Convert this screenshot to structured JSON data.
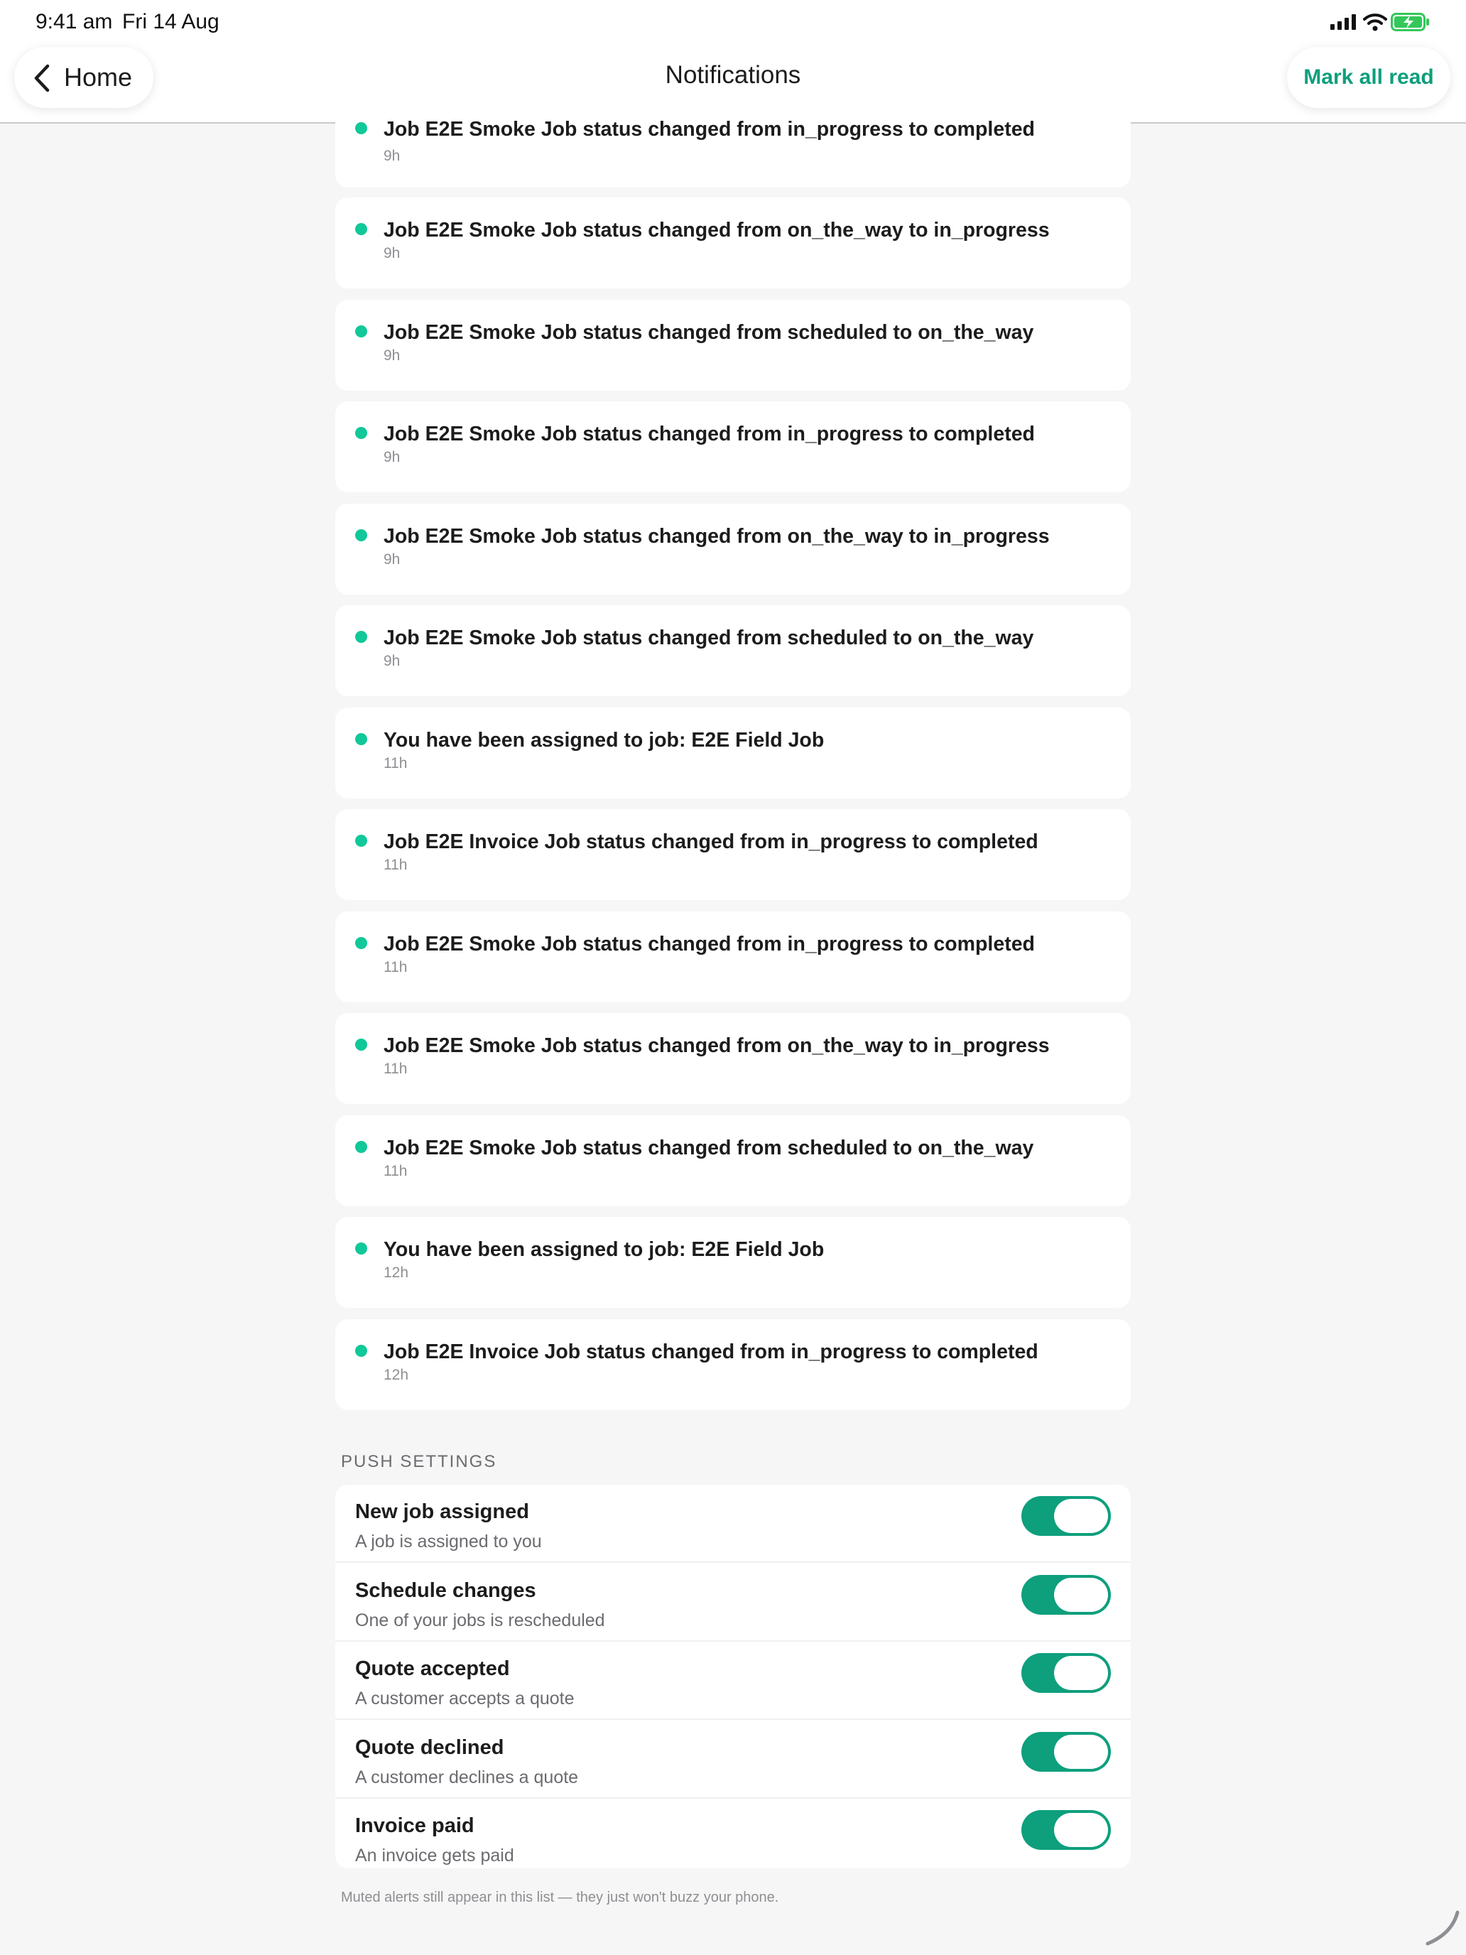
{
  "status_bar": {
    "time": "9:41 am",
    "date": "Fri 14 Aug",
    "icons": [
      "cellular-signal-icon",
      "wifi-icon",
      "battery-charging-icon"
    ],
    "battery_color": "#34c759"
  },
  "nav": {
    "back_label": "Home",
    "title": "Notifications",
    "action_label": "Mark all read"
  },
  "colors": {
    "accent": "#0e9f7c",
    "unread_dot": "#10c898"
  },
  "notifications": [
    {
      "text": "Job E2E Smoke Job status changed from in_progress to completed",
      "time": "9h",
      "unread": true
    },
    {
      "text": "Job E2E Smoke Job status changed from on_the_way to in_progress",
      "time": "9h",
      "unread": true
    },
    {
      "text": "Job E2E Smoke Job status changed from scheduled to on_the_way",
      "time": "9h",
      "unread": true
    },
    {
      "text": "Job E2E Smoke Job status changed from in_progress to completed",
      "time": "9h",
      "unread": true
    },
    {
      "text": "Job E2E Smoke Job status changed from on_the_way to in_progress",
      "time": "9h",
      "unread": true
    },
    {
      "text": "Job E2E Smoke Job status changed from scheduled to on_the_way",
      "time": "9h",
      "unread": true
    },
    {
      "text": "You have been assigned to job: E2E Field Job",
      "time": "11h",
      "unread": true
    },
    {
      "text": "Job E2E Invoice Job status changed from in_progress to completed",
      "time": "11h",
      "unread": true
    },
    {
      "text": "Job E2E Smoke Job status changed from in_progress to completed",
      "time": "11h",
      "unread": true
    },
    {
      "text": "Job E2E Smoke Job status changed from on_the_way to in_progress",
      "time": "11h",
      "unread": true
    },
    {
      "text": "Job E2E Smoke Job status changed from scheduled to on_the_way",
      "time": "11h",
      "unread": true
    },
    {
      "text": "You have been assigned to job: E2E Field Job",
      "time": "12h",
      "unread": true
    },
    {
      "text": "Job E2E Invoice Job status changed from in_progress to completed",
      "time": "12h",
      "unread": true
    }
  ],
  "push_settings": {
    "header": "PUSH SETTINGS",
    "items": [
      {
        "title": "New job assigned",
        "subtitle": "A job is assigned to you",
        "enabled": true
      },
      {
        "title": "Schedule changes",
        "subtitle": "One of your jobs is rescheduled",
        "enabled": true
      },
      {
        "title": "Quote accepted",
        "subtitle": "A customer accepts a quote",
        "enabled": true
      },
      {
        "title": "Quote declined",
        "subtitle": "A customer declines a quote",
        "enabled": true
      },
      {
        "title": "Invoice paid",
        "subtitle": "An invoice gets paid",
        "enabled": true
      }
    ],
    "footnote": "Muted alerts still appear in this list — they just won't buzz your phone."
  }
}
